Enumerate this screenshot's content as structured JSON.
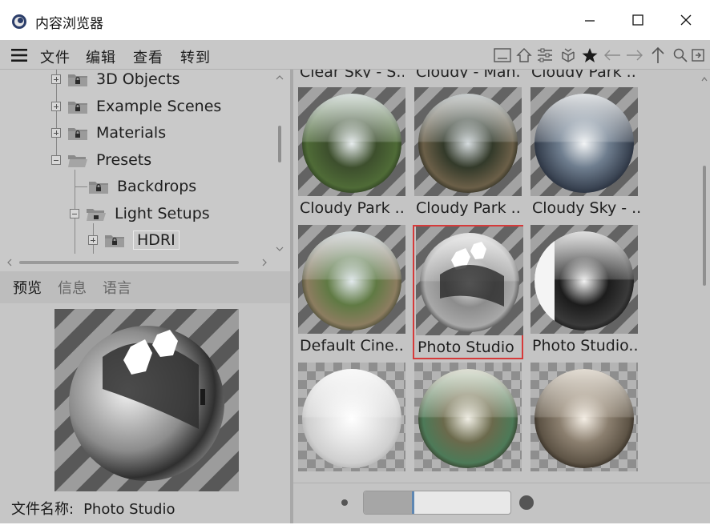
{
  "window": {
    "title": "内容浏览器",
    "minimize_glyph": "–",
    "maximize_glyph": "□",
    "close_glyph": "✕"
  },
  "menu": {
    "items": [
      "文件",
      "编辑",
      "查看",
      "转到"
    ]
  },
  "toolbar": {
    "icons": [
      "layout-icon",
      "home-icon",
      "filter-icon",
      "cube-icon",
      "star-icon",
      "back-arrow-icon",
      "forward-arrow-icon",
      "up-arrow-icon",
      "search-icon",
      "new-window-icon"
    ]
  },
  "tree": {
    "items": [
      {
        "label": "3D Objects"
      },
      {
        "label": "Example Scenes"
      },
      {
        "label": "Materials"
      },
      {
        "label": "Presets"
      },
      {
        "label": "Backdrops"
      },
      {
        "label": "Light Setups"
      },
      {
        "label": "HDRI"
      }
    ]
  },
  "preview": {
    "tabs": [
      "预览",
      "信息",
      "语言"
    ],
    "filename_label": "文件名称:",
    "filename_value": "Photo Studio"
  },
  "grid": {
    "cut_labels": [
      "Clear Sky - S...",
      "Cloudy - Man...",
      "Cloudy Park ..."
    ],
    "items": [
      {
        "label": "Cloudy Park ..",
        "style": "park"
      },
      {
        "label": "Cloudy Park ..",
        "style": "park-dark"
      },
      {
        "label": "Cloudy Sky - ..",
        "style": "sky"
      },
      {
        "label": "Default Cine..",
        "style": "park-light"
      },
      {
        "label": "Photo Studio",
        "style": "studio",
        "selected": true
      },
      {
        "label": "Photo Studio..",
        "style": "studio-dark"
      },
      {
        "label": "",
        "style": "white"
      },
      {
        "label": "",
        "style": "room"
      },
      {
        "label": "",
        "style": "metal"
      }
    ]
  },
  "zoom": {
    "level_fraction": 0.33
  },
  "colors": {
    "selection_border": "#d63a3a",
    "slider_marker": "#5e87b3"
  }
}
